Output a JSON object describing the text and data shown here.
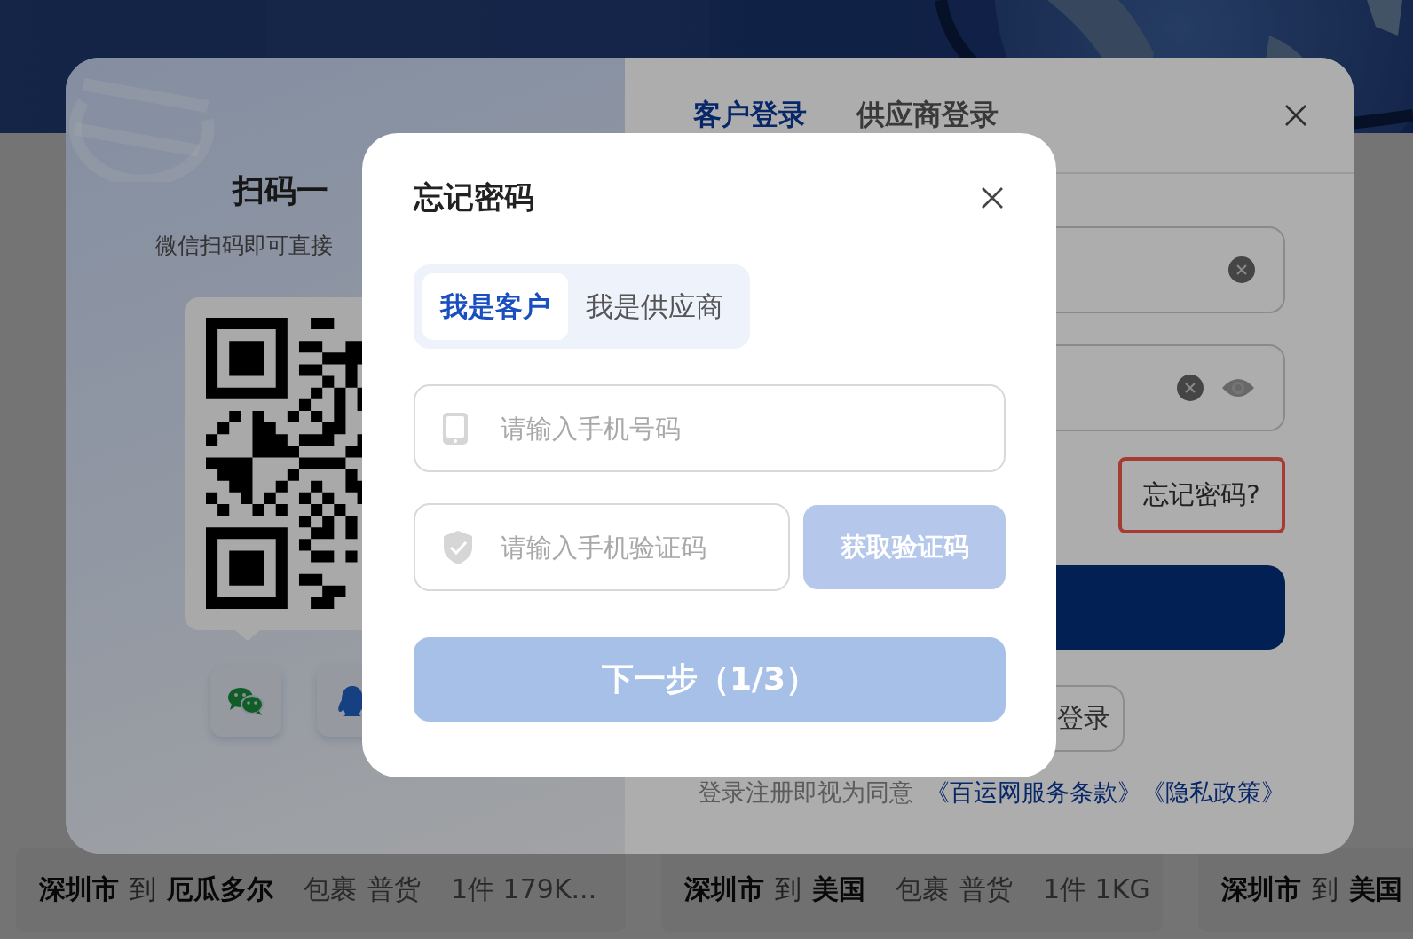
{
  "page": {
    "route_cards": [
      {
        "origin": "深圳市",
        "connector": "到",
        "destination": "厄瓜多尔",
        "tags": [
          "包裹",
          "普货"
        ],
        "quantity": "1件 179K..."
      },
      {
        "origin": "深圳市",
        "connector": "到",
        "destination": "美国",
        "tags": [
          "包裹",
          "普货"
        ],
        "quantity": "1件 1KG"
      },
      {
        "origin": "深圳市",
        "connector": "到",
        "destination": "美国"
      }
    ]
  },
  "login_modal": {
    "qr_panel": {
      "title": "扫码一",
      "subtitle": "微信扫码即可直接"
    },
    "tabs": [
      {
        "label": "客户登录",
        "selected": true
      },
      {
        "label": "供应商登录",
        "selected": false
      }
    ],
    "forgot_link": {
      "label": "忘记密码?",
      "highlighted": true
    },
    "secondary_button": "登录",
    "agreement": {
      "text": "登录注册即视为同意",
      "links": [
        "《百运网服务条款》",
        "《隐私政策》"
      ]
    }
  },
  "dialog": {
    "title": "忘记密码",
    "roles": [
      {
        "label": "我是客户",
        "selected": true
      },
      {
        "label": "我是供应商",
        "selected": false
      }
    ],
    "phone_field": {
      "placeholder": "请输入手机号码"
    },
    "code_field": {
      "placeholder": "请输入手机验证码"
    },
    "code_button": {
      "label": "获取验证码",
      "disabled": true
    },
    "next_button": {
      "label": "下一步（1/3）",
      "disabled": true
    }
  }
}
